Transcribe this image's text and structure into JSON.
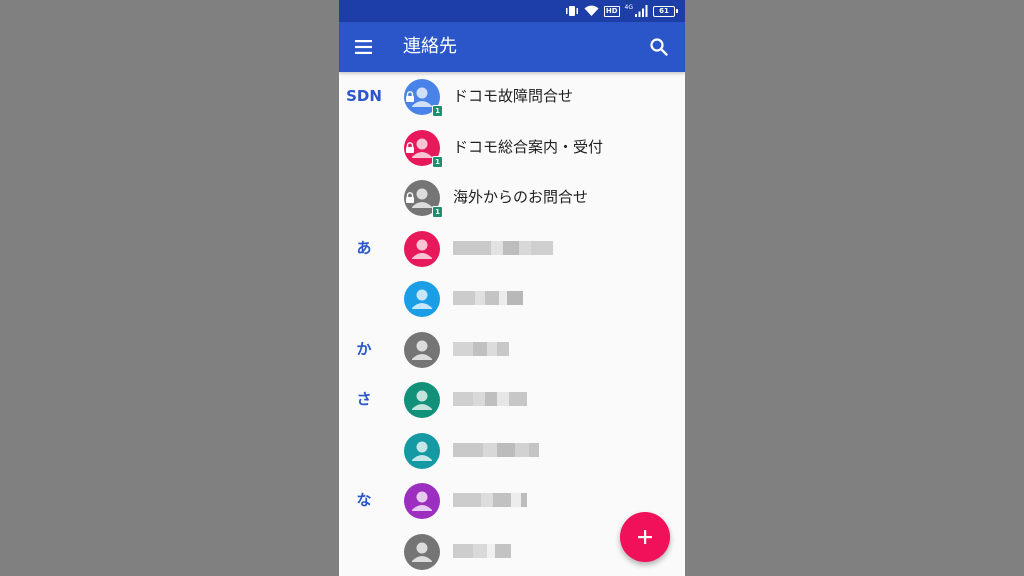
{
  "status_bar": {
    "hd_label": "HD",
    "network_label": "4G",
    "battery_level": "61"
  },
  "app_bar": {
    "title": "連絡先"
  },
  "colors": {
    "status_bar": "#1d3ea6",
    "app_bar": "#2a56c9",
    "accent": "#2a56c9",
    "fab": "#f0115a"
  },
  "contacts": [
    {
      "section": "SDN",
      "name": "ドコモ故障問合せ",
      "avatar_color": "#4a83e8",
      "locked": true
    },
    {
      "section": "",
      "name": "ドコモ総合案内・受付",
      "avatar_color": "#e8195a",
      "locked": true
    },
    {
      "section": "",
      "name": "海外からのお問合せ",
      "avatar_color": "#757575",
      "locked": true
    },
    {
      "section": "あ",
      "name": "",
      "avatar_color": "#e8195a",
      "locked": false
    },
    {
      "section": "",
      "name": "",
      "avatar_color": "#1a9ee6",
      "locked": false
    },
    {
      "section": "か",
      "name": "",
      "avatar_color": "#757575",
      "locked": false
    },
    {
      "section": "さ",
      "name": "",
      "avatar_color": "#12917a",
      "locked": false
    },
    {
      "section": "",
      "name": "",
      "avatar_color": "#159aa3",
      "locked": false
    },
    {
      "section": "な",
      "name": "",
      "avatar_color": "#9d2fc0",
      "locked": false
    },
    {
      "section": "",
      "name": "",
      "avatar_color": "#757575",
      "locked": false
    }
  ],
  "icons": {
    "menu": "menu-icon",
    "search": "search-icon",
    "fab": "plus-icon",
    "avatar": "person-icon",
    "lock": "lock-icon",
    "sim": "sim-badge-icon"
  }
}
